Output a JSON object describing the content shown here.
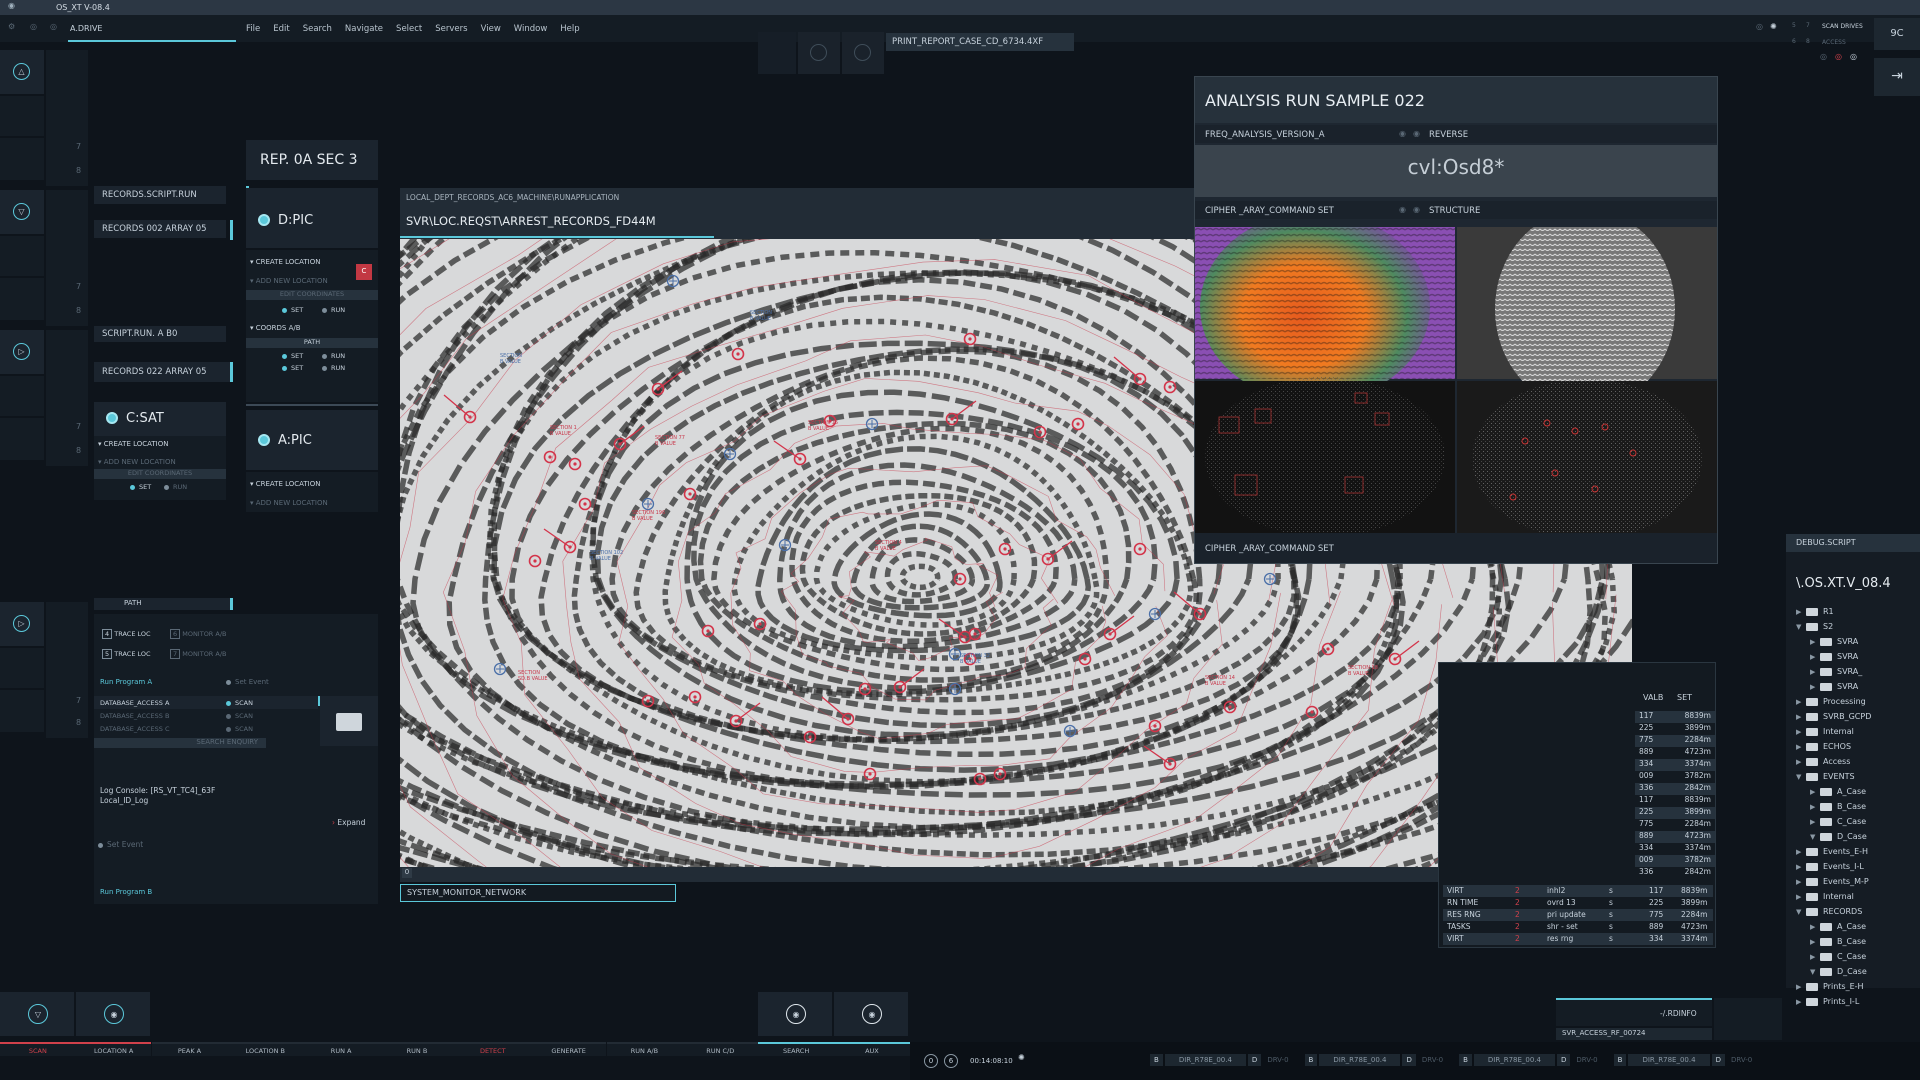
{
  "topbar": {
    "title": "OS_XT V-08.4"
  },
  "menubar": {
    "drive": "A.DRIVE",
    "items": [
      "File",
      "Edit",
      "Search",
      "Navigate",
      "Select",
      "Servers",
      "View",
      "Window",
      "Help"
    ]
  },
  "print_report": "PRINT_REPORT_CASE_CD_6734.4XF",
  "top_right": {
    "scan": "SCAN DRIVES",
    "access": "ACCESS",
    "n1": "7",
    "n2": "5",
    "n3": "6",
    "n4": "8",
    "num": "9C"
  },
  "rail": {
    "nums": [
      "7",
      "8",
      "7",
      "8",
      "7",
      "8",
      "7",
      "8"
    ]
  },
  "left": {
    "rec_script": "RECORDS.SCRIPT.RUN",
    "rec002": "RECORDS 002 ARRAY 05",
    "script_a": "SCRIPT.RUN. A B0",
    "rec022": "RECORDS 022 ARRAY 05",
    "csat": "C:SAT",
    "create": "CREATE LOCATION",
    "addnew": "ADD NEW LOCATION",
    "edit": "EDIT COORDINATES",
    "set": "SET",
    "run": "RUN",
    "path": "PATH",
    "trace1": "TRACE LOC",
    "trace2": "TRACE LOC",
    "mon1": "MONITOR A/B",
    "mon2": "MONITOR A/B",
    "k4": "4",
    "k5": "5",
    "k6": "6",
    "k7": "7",
    "run_prog_a": "Run Program A",
    "set_event": "Set Event",
    "db": [
      {
        "name": "DATABASE_ACCESS A",
        "state": "SCAN"
      },
      {
        "name": "DATABASE_ACCESS B",
        "state": "SCAN"
      },
      {
        "name": "DATABASE_ACCESS C",
        "state": "SCAN"
      }
    ],
    "search": "SEARCH ENQUIRY",
    "log1": "Log Console: [RS_VT_TC4]_63F",
    "log2": "Local_ID_Log",
    "expand": "Expand",
    "set_event2": "Set Event",
    "run_prog_b": "Run Program B"
  },
  "mid": {
    "rep": "REP. 0A SEC 3",
    "dpic": "D:PIC",
    "apic": "A:PIC",
    "create": "CREATE LOCATION",
    "addnew": "ADD NEW LOCATION",
    "edit": "EDIT COORDINATES",
    "set": "SET",
    "run": "RUN",
    "coords": "COORDS A/B",
    "path": "PATH",
    "c": "C"
  },
  "viewer": {
    "breadcrumb": "LOCAL_DEPT_RECORDS_AC6_MACHINE\\RUNAPPLICATION",
    "path": "SVR\\LOC.REQST\\ARREST_RECORDS_FD44M",
    "corner": "0"
  },
  "sysmon": "SYSTEM_MONITOR_NETWORK",
  "analysis": {
    "title": "ANALYSIS RUN SAMPLE 022",
    "freq": "FREQ_ANALYSIS_VERSION_A",
    "reverse": "REVERSE",
    "code": "cvl:Osd8*",
    "cipher": "CIPHER _ARAY_COMMAND SET",
    "structure": "STRUCTURE",
    "cipher2": "CIPHER _ARAY_COMMAND SET"
  },
  "table": {
    "h1": "VALB",
    "h2": "SET",
    "rows": [
      [
        "117",
        "8839m"
      ],
      [
        "225",
        "3899m"
      ],
      [
        "775",
        "2284m"
      ],
      [
        "889",
        "4723m"
      ],
      [
        "334",
        "3374m"
      ],
      [
        "009",
        "3782m"
      ],
      [
        "336",
        "2842m"
      ],
      [
        "117",
        "8839m"
      ],
      [
        "225",
        "3899m"
      ],
      [
        "775",
        "2284m"
      ],
      [
        "889",
        "4723m"
      ],
      [
        "334",
        "3374m"
      ],
      [
        "009",
        "3782m"
      ],
      [
        "336",
        "2842m"
      ]
    ],
    "proc": [
      [
        "VIRT",
        "2",
        "inhl2",
        "s",
        "117",
        "8839m"
      ],
      [
        "RN TIME",
        "2",
        "ovrd  13",
        "s",
        "225",
        "3899m"
      ],
      [
        "RES RNG",
        "2",
        "pri update",
        "s",
        "775",
        "2284m"
      ],
      [
        "TASKS",
        "2",
        "shr - set",
        "s",
        "889",
        "4723m"
      ],
      [
        "VIRT",
        "2",
        "res rng",
        "s",
        "334",
        "3374m"
      ]
    ]
  },
  "debug": {
    "label": "DEBUG.SCRIPT",
    "title": "\\.OS.XT.V_08.4",
    "tree": [
      {
        "l": 0,
        "t": "R1",
        "o": false
      },
      {
        "l": 0,
        "t": "S2",
        "o": true
      },
      {
        "l": 1,
        "t": "SVRA",
        "o": false
      },
      {
        "l": 1,
        "t": "SVRA",
        "o": false
      },
      {
        "l": 1,
        "t": "SVRA_",
        "o": false
      },
      {
        "l": 1,
        "t": "SVRA",
        "o": false
      },
      {
        "l": 0,
        "t": "Processing",
        "o": false
      },
      {
        "l": 0,
        "t": "SVRB_GCPD",
        "o": false
      },
      {
        "l": 0,
        "t": "Internal",
        "o": false
      },
      {
        "l": 0,
        "t": "ECHOS",
        "o": false
      },
      {
        "l": 0,
        "t": "Access",
        "o": false
      },
      {
        "l": 0,
        "t": "EVENTS",
        "o": true
      },
      {
        "l": 1,
        "t": "A_Case",
        "o": false
      },
      {
        "l": 1,
        "t": "B_Case",
        "o": false
      },
      {
        "l": 1,
        "t": "C_Case",
        "o": false
      },
      {
        "l": 1,
        "t": "D_Case",
        "o": true
      },
      {
        "l": 0,
        "t": "Events_E-H",
        "o": false
      },
      {
        "l": 0,
        "t": "Events_I-L",
        "o": false
      },
      {
        "l": 0,
        "t": "Events_M-P",
        "o": false
      },
      {
        "l": 0,
        "t": "Internal",
        "o": false
      },
      {
        "l": 0,
        "t": "RECORDS",
        "o": true
      },
      {
        "l": 1,
        "t": "A_Case",
        "o": false
      },
      {
        "l": 1,
        "t": "B_Case",
        "o": false
      },
      {
        "l": 1,
        "t": "C_Case",
        "o": false
      },
      {
        "l": 1,
        "t": "D_Case",
        "o": true
      },
      {
        "l": 0,
        "t": "Prints_E-H",
        "o": false
      },
      {
        "l": 0,
        "t": "Prints_I-L",
        "o": false
      }
    ]
  },
  "rdinfo": "-/.RDINFO",
  "svr_access": "SVR_ACCESS_RF_00724",
  "bottom": {
    "tabs": [
      "SCAN",
      "LOCATION A",
      "PEAK A",
      "LOCATION B",
      "RUN A",
      "RUN B",
      "DETECT",
      "GENERATE",
      "RUN A/B",
      "RUN C/D",
      "SEARCH",
      "AUX"
    ],
    "time": "00:14:08:10",
    "n0": "0",
    "n6": "6",
    "drives": [
      {
        "b": "B",
        "n": "DIR_R78E_00.4",
        "d": "D",
        "dv": "DRV-0"
      },
      {
        "b": "B",
        "n": "DIR_R78E_00.4",
        "d": "D",
        "dv": "DRV-0"
      },
      {
        "b": "B",
        "n": "DIR_R78E_00.4",
        "d": "D",
        "dv": "DRV-0"
      },
      {
        "b": "B",
        "n": "DIR_R78E_00.4",
        "d": "D",
        "dv": "DRV-0"
      }
    ]
  },
  "fp_labels": [
    "SECTION\nB VALUE",
    "SECTION 1\nB VALUE",
    "SECTION 77\nB VALUE",
    "SECTION\nB VALUE",
    "SECTION 16\nB VALUE",
    "SECTION 196\nB VALUE",
    "SECTION 102\nB VALUE",
    "SECTION 4\nB VALUE",
    "SECTION\nSD.B VALUE",
    "SECTION 32\nB VALUE",
    "SECTION 14\nB VALUE",
    "SECTION 18\nB VALUE"
  ]
}
